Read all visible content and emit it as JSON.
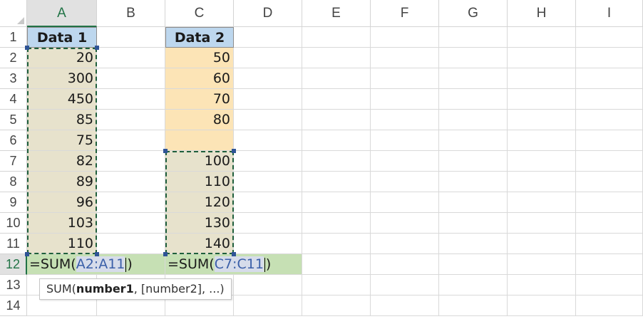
{
  "columns": [
    "A",
    "B",
    "C",
    "D",
    "E",
    "F",
    "G",
    "H",
    "I"
  ],
  "rows": [
    "1",
    "2",
    "3",
    "4",
    "5",
    "6",
    "7",
    "8",
    "9",
    "10",
    "11",
    "12",
    "13",
    "14"
  ],
  "selected_column": "A",
  "selected_row": "12",
  "table1": {
    "header": "Data 1",
    "values": [
      "20",
      "300",
      "450",
      "85",
      "75",
      "82",
      "89",
      "96",
      "103",
      "110"
    ]
  },
  "table2": {
    "header": "Data 2",
    "values": [
      "50",
      "60",
      "70",
      "80",
      "",
      "100",
      "110",
      "120",
      "130",
      "140"
    ]
  },
  "formula_a12": {
    "prefix": "=SUM(",
    "ref": "A2:A11",
    "suffix": ")"
  },
  "formula_c12": {
    "prefix": "=SUM(",
    "ref": "C7:C11",
    "suffix": ")"
  },
  "tooltip": {
    "func": "SUM(",
    "arg1": "number1",
    "rest": ", [number2], ...)"
  },
  "colors": {
    "header_fill": "#bdd7ee",
    "data1_fill": "#e7e2cc",
    "data2_fill": "#fce4b6",
    "formula_fill": "#c6e0b4",
    "reference_border": "#1f5f3c"
  }
}
